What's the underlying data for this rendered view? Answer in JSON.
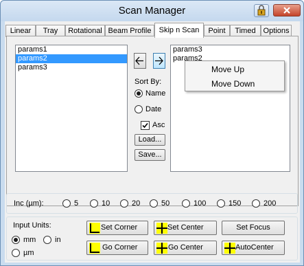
{
  "window": {
    "title": "Scan Manager",
    "lock_icon": "lock-icon",
    "close_icon": "close-x-icon"
  },
  "tabs": [
    {
      "label": "Linear"
    },
    {
      "label": "Tray"
    },
    {
      "label": "Rotational"
    },
    {
      "label": "Beam Profile"
    },
    {
      "label": "Skip n Scan",
      "active": true
    },
    {
      "label": "Point"
    },
    {
      "label": "Timed"
    },
    {
      "label": "Options"
    }
  ],
  "left_list": {
    "items": [
      {
        "label": "params1",
        "selected": false
      },
      {
        "label": "params2",
        "selected": true
      },
      {
        "label": "params3",
        "selected": false
      }
    ]
  },
  "right_list": {
    "items": [
      {
        "label": "params3"
      },
      {
        "label": "params2"
      }
    ]
  },
  "move_left_icon": "arrow-left-icon",
  "move_right_icon": "arrow-right-icon",
  "sort": {
    "label": "Sort By:",
    "options": [
      {
        "label": "Name",
        "checked": true
      },
      {
        "label": "Date",
        "checked": false
      }
    ],
    "asc_label": "Asc",
    "asc_checked": true
  },
  "buttons": {
    "load": "Load...",
    "save": "Save..."
  },
  "context_menu": {
    "items": [
      "Move Up",
      "Move Down"
    ]
  },
  "increment": {
    "label": "Inc (µm):",
    "options": [
      "5",
      "10",
      "20",
      "50",
      "100",
      "150",
      "200"
    ]
  },
  "units": {
    "label": "Input Units:",
    "options": [
      {
        "label": "mm",
        "checked": true
      },
      {
        "label": "in",
        "checked": false
      },
      {
        "label": "µm",
        "checked": false
      }
    ]
  },
  "actions": {
    "set_corner": "Set Corner",
    "set_center": "Set Center",
    "set_focus": "Set Focus",
    "go_corner": "Go Corner",
    "go_center": "Go Center",
    "auto_center": "AutoCenter"
  },
  "colors": {
    "selection": "#3399ff",
    "icon_yellow": "#ffff00",
    "close_red": "#c4442a"
  }
}
